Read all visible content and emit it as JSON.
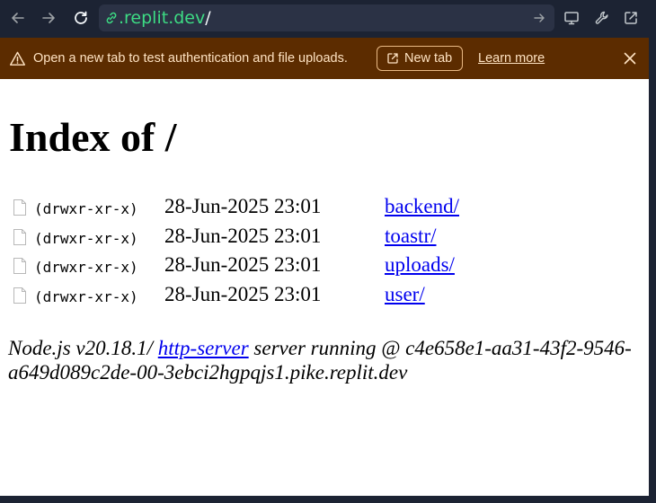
{
  "browser": {
    "url_host": ".replit.dev",
    "url_path": "/",
    "icons": {
      "back": "arrow-left-icon",
      "forward": "arrow-right-icon",
      "reload": "reload-icon",
      "link": "link-icon",
      "go": "arrow-right-icon",
      "devtools_screen": "monitor-icon",
      "devtools": "wrench-icon",
      "open_external": "external-link-icon"
    },
    "colors": {
      "toolbar_bg": "#1c2333",
      "url_host": "#3ddc84"
    }
  },
  "banner": {
    "message": "Open a new tab to test authentication and file uploads.",
    "new_tab_label": "New tab",
    "learn_more_label": "Learn more",
    "colors": {
      "background": "#5c2c00",
      "text": "#ffe3c2"
    }
  },
  "page": {
    "title": "Index of /",
    "entries": [
      {
        "permissions": "(drwxr-xr-x)",
        "date": "28-Jun-2025 23:01",
        "name": "backend/"
      },
      {
        "permissions": "(drwxr-xr-x)",
        "date": "28-Jun-2025 23:01",
        "name": "toastr/"
      },
      {
        "permissions": "(drwxr-xr-x)",
        "date": "28-Jun-2025 23:01",
        "name": "uploads/"
      },
      {
        "permissions": "(drwxr-xr-x)",
        "date": "28-Jun-2025 23:01",
        "name": "user/"
      }
    ],
    "footer": {
      "prefix": "Node.js v20.18.1/ ",
      "link_text": "http-server",
      "suffix": " server running @ c4e658e1-aa31-43f2-9546-a649d089c2de-00-3ebci2hgpqjs1.pike.replit.dev"
    }
  }
}
